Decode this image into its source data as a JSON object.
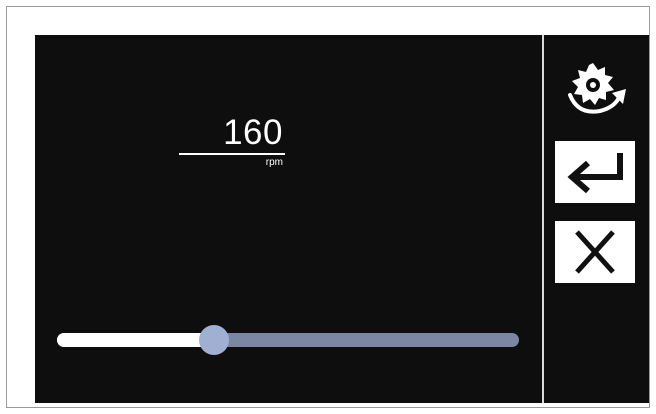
{
  "speed": {
    "value": "160",
    "unit": "rpm"
  },
  "slider": {
    "fraction": 0.34
  },
  "side_panel": {
    "buttons": [
      {
        "name": "rotate-saw",
        "icon": "saw-blade-rotate-icon"
      },
      {
        "name": "enter",
        "icon": "enter-return-icon"
      },
      {
        "name": "cancel",
        "icon": "close-icon"
      }
    ]
  },
  "colors": {
    "screen_bg": "#0e0e0e",
    "text": "#ffffff",
    "slider_track": "#7a86a2",
    "slider_fill": "#ffffff",
    "slider_thumb": "#9fb0d3",
    "button_bg": "#ffffff"
  }
}
